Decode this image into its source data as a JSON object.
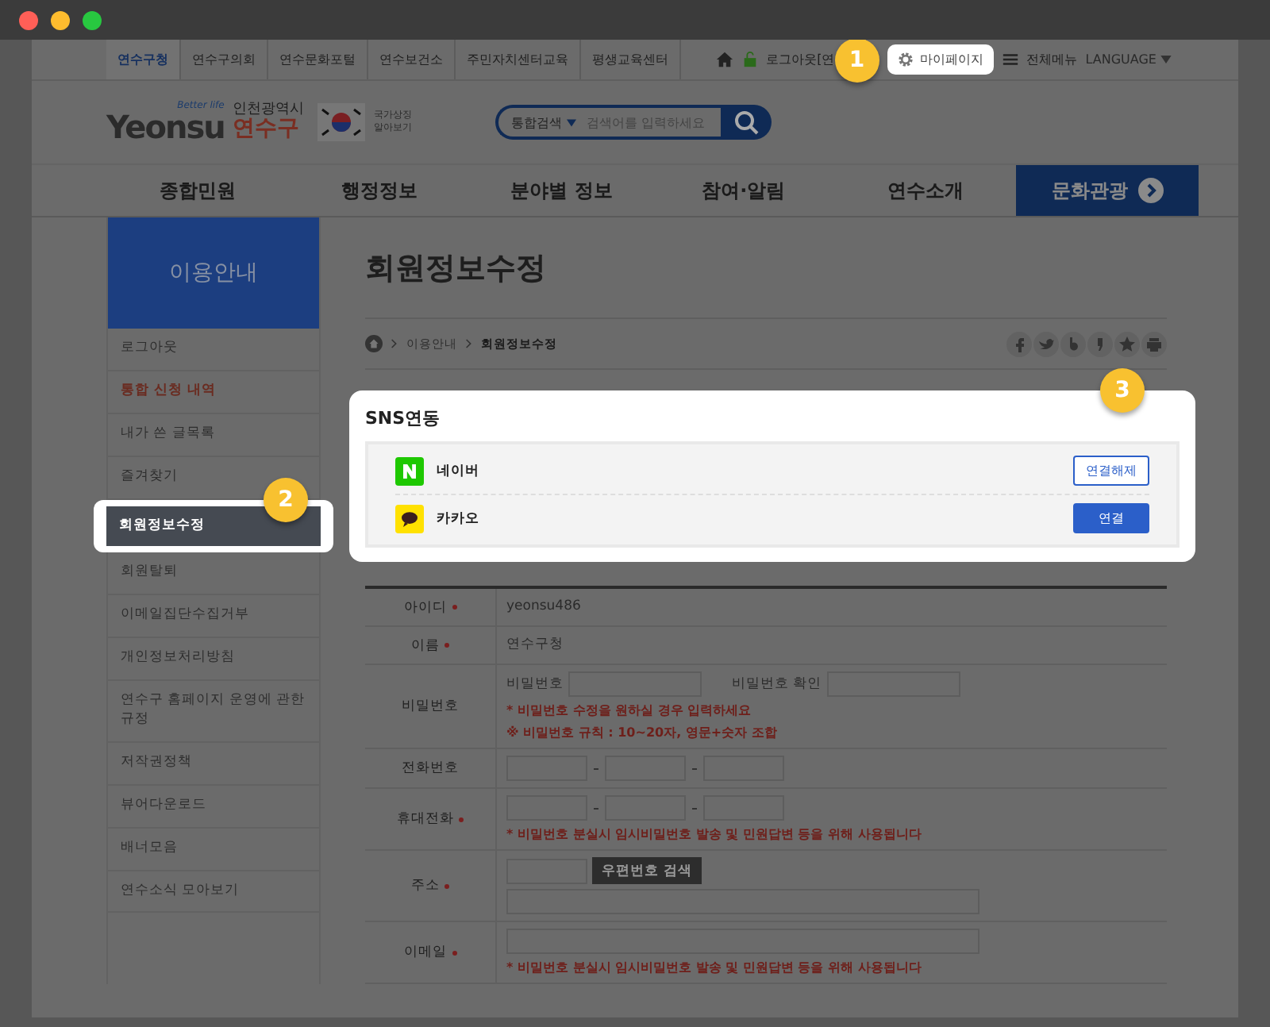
{
  "util_links": [
    {
      "label": "연수구청",
      "selected": true
    },
    {
      "label": "연수구의회",
      "selected": false
    },
    {
      "label": "연수문화포털",
      "selected": false
    },
    {
      "label": "연수보건소",
      "selected": false
    },
    {
      "label": "주민자치센터교육",
      "selected": false
    },
    {
      "label": "평생교육센터",
      "selected": false
    }
  ],
  "util_right": {
    "logout": "로그아웃[연",
    "mypage": "마이페이지",
    "all_menu": "전체메뉴",
    "language": "LANGUAGE"
  },
  "callouts": [
    "1",
    "2",
    "3"
  ],
  "logo": {
    "tagline": "Better life",
    "wordmark": "Yeonsu",
    "city": "인천광역시",
    "district": "연수구",
    "symbol_link": "국가상징 알아보기"
  },
  "search": {
    "scope": "통합검색",
    "placeholder": "검색어를 입력하세요"
  },
  "nav": [
    {
      "label": "종합민원",
      "selected": false
    },
    {
      "label": "행정정보",
      "selected": false
    },
    {
      "label": "분야별 정보",
      "selected": false
    },
    {
      "label": "참여·알림",
      "selected": false
    },
    {
      "label": "연수소개",
      "selected": false
    },
    {
      "label": "문화관광",
      "selected": true
    }
  ],
  "sidebar": {
    "title": "이용안내",
    "items": [
      {
        "label": "로그아웃",
        "selected": false,
        "emphasized": false
      },
      {
        "label": "통합 신청 내역",
        "selected": false,
        "emphasized": true
      },
      {
        "label": "내가 쓴 글목록",
        "selected": false,
        "emphasized": false
      },
      {
        "label": "즐겨찾기",
        "selected": false,
        "emphasized": false
      },
      {
        "label": "회원정보수정",
        "selected": true,
        "emphasized": false
      },
      {
        "label": "회원탈퇴",
        "selected": false,
        "emphasized": false
      },
      {
        "label": "이메일집단수집거부",
        "selected": false,
        "emphasized": false
      },
      {
        "label": "개인정보처리방침",
        "selected": false,
        "emphasized": false
      },
      {
        "label": "연수구 홈페이지 운영에 관한 규정",
        "selected": false,
        "emphasized": false
      },
      {
        "label": "저작권정책",
        "selected": false,
        "emphasized": false
      },
      {
        "label": "뷰어다운로드",
        "selected": false,
        "emphasized": false
      },
      {
        "label": "배너모음",
        "selected": false,
        "emphasized": false
      },
      {
        "label": "연수소식 모아보기",
        "selected": false,
        "emphasized": false
      }
    ]
  },
  "page_title": "회원정보수정",
  "breadcrumb": [
    "이용안내",
    "회원정보수정"
  ],
  "sns": {
    "title": "SNS연동",
    "accounts": [
      {
        "kind": "naver",
        "name": "네이버",
        "connected": true,
        "button": "연결해제"
      },
      {
        "kind": "kakao",
        "name": "카카오",
        "connected": false,
        "button": "연결"
      }
    ]
  },
  "form": [
    {
      "kind": "text",
      "label": "아이디",
      "required": true,
      "value": "yeonsu486"
    },
    {
      "kind": "text",
      "label": "이름",
      "required": true,
      "value": "연수구청"
    },
    {
      "kind": "password",
      "label": "비밀번호",
      "required": false,
      "field1": "비밀번호",
      "field2": "비밀번호 확인",
      "notes": [
        "* 비밀번호 수정을 원하실 경우 입력하세요",
        "※ 비밀번호 규칙 : 10~20자, 영문+숫자 조합"
      ]
    },
    {
      "kind": "phone",
      "label": "전화번호",
      "required": false
    },
    {
      "kind": "phone",
      "label": "휴대전화",
      "required": true,
      "notes": [
        "* 비밀번호 분실시 임시비밀번호 발송 및 민원답변 등을 위해 사용됩니다"
      ]
    },
    {
      "kind": "address",
      "label": "주소",
      "required": true,
      "button": "우편번호 검색"
    },
    {
      "kind": "email",
      "label": "이메일",
      "required": true,
      "notes": [
        "* 비밀번호 분실시 임시비밀번호 발송 및 민원답변 등을 위해 사용됩니다"
      ]
    }
  ]
}
